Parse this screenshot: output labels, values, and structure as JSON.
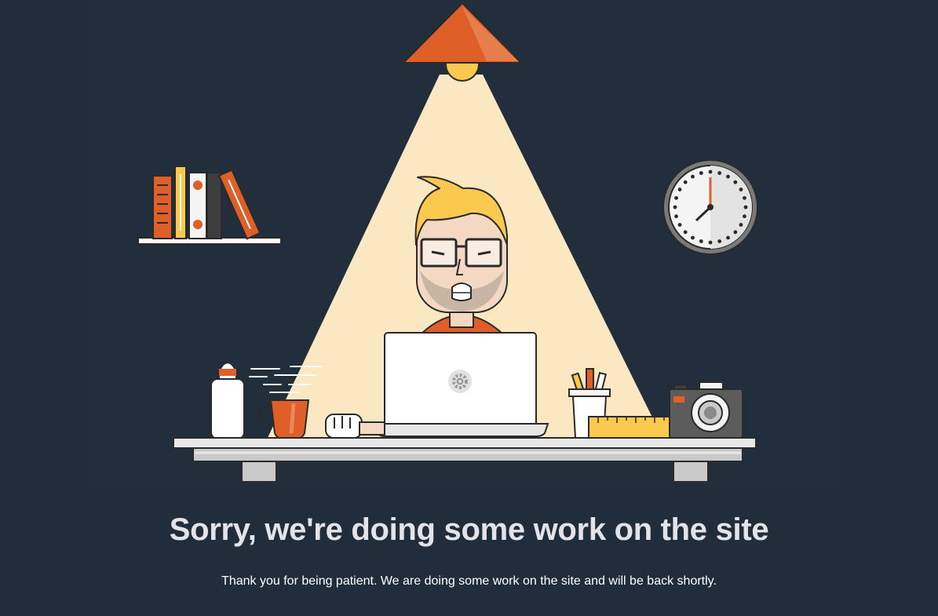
{
  "page": {
    "headline": "Sorry, we're doing some work on the site",
    "message": "Thank you for being patient. We are doing some work on the site and will be back shortly."
  },
  "illustration": {
    "scene": [
      "ceiling-lamp",
      "light-beam",
      "bookshelf",
      "wall-clock",
      "developer",
      "laptop",
      "gear-icon",
      "water-bottle",
      "coffee-mug",
      "pencil-cup",
      "ruler",
      "camera",
      "desk"
    ]
  },
  "colors": {
    "background": "#222d3c",
    "accent_orange": "#de5f27",
    "accent_yellow": "#fbc94d",
    "light_beam": "#fbe8c2",
    "headline_text": "#e4e4e8",
    "body_text": "#ffffff"
  }
}
